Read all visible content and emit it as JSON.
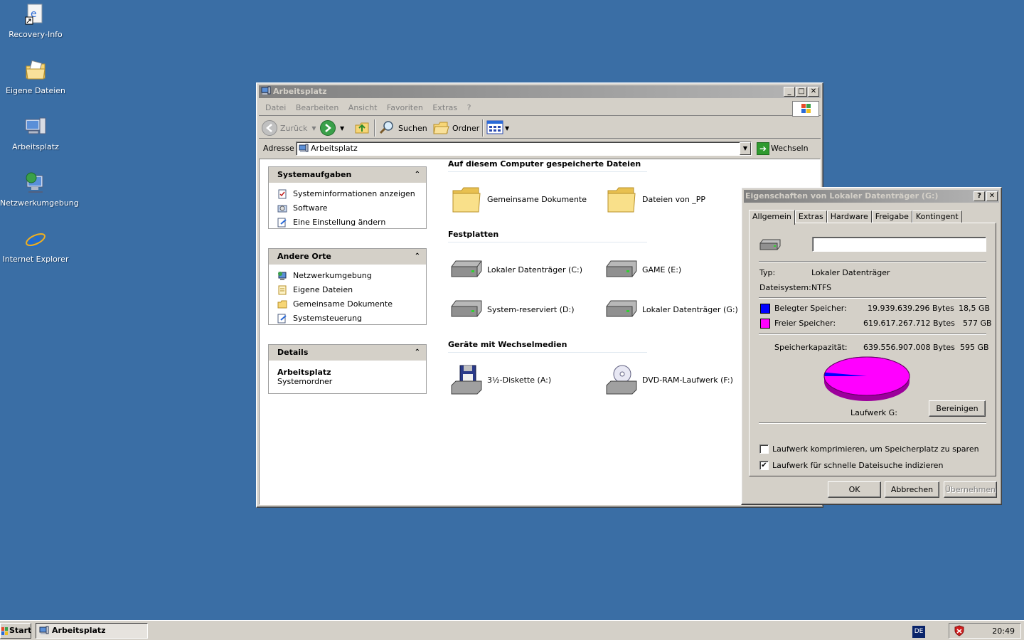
{
  "desktop": {
    "icons": [
      {
        "label": "Recovery-Info",
        "icon": "recovery-shortcut-icon"
      },
      {
        "label": "Eigene Dateien",
        "icon": "my-documents-icon"
      },
      {
        "label": "Arbeitsplatz",
        "icon": "my-computer-icon"
      },
      {
        "label": "Netzwerkumgebung",
        "icon": "network-places-icon"
      },
      {
        "label": "Internet Explorer",
        "icon": "internet-explorer-icon"
      }
    ]
  },
  "explorer": {
    "title": "Arbeitsplatz",
    "menu": [
      "Datei",
      "Bearbeiten",
      "Ansicht",
      "Favoriten",
      "Extras",
      "?"
    ],
    "toolbar": {
      "back": "Zurück",
      "search": "Suchen",
      "folders": "Ordner"
    },
    "address": {
      "label": "Adresse",
      "value": "Arbeitsplatz",
      "go": "Wechseln zu"
    },
    "panes": {
      "system_tasks": {
        "title": "Systemaufgaben",
        "items": [
          "Systeminformationen anzeigen",
          "Software",
          "Eine Einstellung ändern"
        ]
      },
      "other_places": {
        "title": "Andere Orte",
        "items": [
          "Netzwerkumgebung",
          "Eigene Dateien",
          "Gemeinsame Dokumente",
          "Systemsteuerung"
        ]
      },
      "details": {
        "title": "Details",
        "name": "Arbeitsplatz",
        "type": "Systemordner"
      }
    },
    "groups": {
      "stored_files": {
        "title": "Auf diesem Computer gespeicherte Dateien",
        "items": [
          "Gemeinsame Dokumente",
          "Dateien von _PP"
        ]
      },
      "hard_disks": {
        "title": "Festplatten",
        "items": [
          "Lokaler Datenträger (C:)",
          "GAME (E:)",
          "System-reserviert (D:)",
          "Lokaler Datenträger (G:)"
        ]
      },
      "removable": {
        "title": "Geräte mit Wechselmedien",
        "items": [
          "3½-Diskette (A:)",
          "DVD-RAM-Laufwerk (F:)"
        ]
      }
    }
  },
  "properties": {
    "title": "Eigenschaften von Lokaler Datenträger (G:)",
    "tabs": [
      "Allgemein",
      "Extras",
      "Hardware",
      "Freigabe",
      "Kontingent"
    ],
    "name_value": "",
    "type_label": "Typ:",
    "type_value": "Lokaler Datenträger",
    "fs_label": "Dateisystem:",
    "fs_value": "NTFS",
    "used": {
      "label": "Belegter Speicher:",
      "bytes": "19.939.639.296 Bytes",
      "size": "18,5 GB",
      "color": "#0000ff",
      "fraction": 0.0312
    },
    "free": {
      "label": "Freier Speicher:",
      "bytes": "619.617.267.712 Bytes",
      "size": "577 GB",
      "color": "#ff00ff",
      "fraction": 0.9688
    },
    "capacity": {
      "label": "Speicherkapazität:",
      "bytes": "639.556.907.008 Bytes",
      "size": "595 GB"
    },
    "drive_label": "Laufwerk G:",
    "cleanup": "Bereinigen",
    "compress": {
      "label": "Laufwerk komprimieren, um Speicherplatz zu sparen",
      "checked": false
    },
    "index": {
      "label": "Laufwerk für schnelle Dateisuche indizieren",
      "checked": true
    },
    "buttons": {
      "ok": "OK",
      "cancel": "Abbrechen",
      "apply": "Übernehmen"
    }
  },
  "taskbar": {
    "start": "Start",
    "task": "Arbeitsplatz",
    "lang": "DE",
    "clock": "20:49"
  }
}
